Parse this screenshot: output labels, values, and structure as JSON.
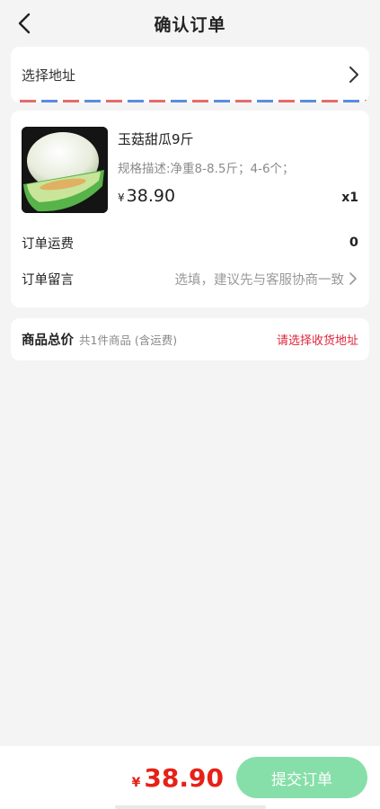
{
  "header": {
    "title": "确认订单",
    "back_icon": "chevron-left-icon"
  },
  "address": {
    "label": "选择地址",
    "arrow_icon": "chevron-right-icon",
    "stripe_colors": [
      "#e66b6b",
      "#5b8de0"
    ]
  },
  "product": {
    "name": "玉菇甜瓜9斤",
    "spec": "规格描述:净重8-8.5斤；4-6个；",
    "price_symbol": "¥",
    "price": "38.90",
    "quantity": "x1",
    "image": "melon-image"
  },
  "shipping": {
    "label": "订单运费",
    "value": "0"
  },
  "note": {
    "label": "订单留言",
    "placeholder": "选填，建议先与客服协商一致",
    "arrow_icon": "chevron-right-icon"
  },
  "summary": {
    "label": "商品总价",
    "sub": "共1件商品 (含运费)",
    "warning": "请选择收货地址"
  },
  "footer": {
    "price_symbol": "¥",
    "total": "38.90",
    "submit_label": "提交订单",
    "accent_red": "#e62117",
    "button_green": "#86dfa8"
  }
}
